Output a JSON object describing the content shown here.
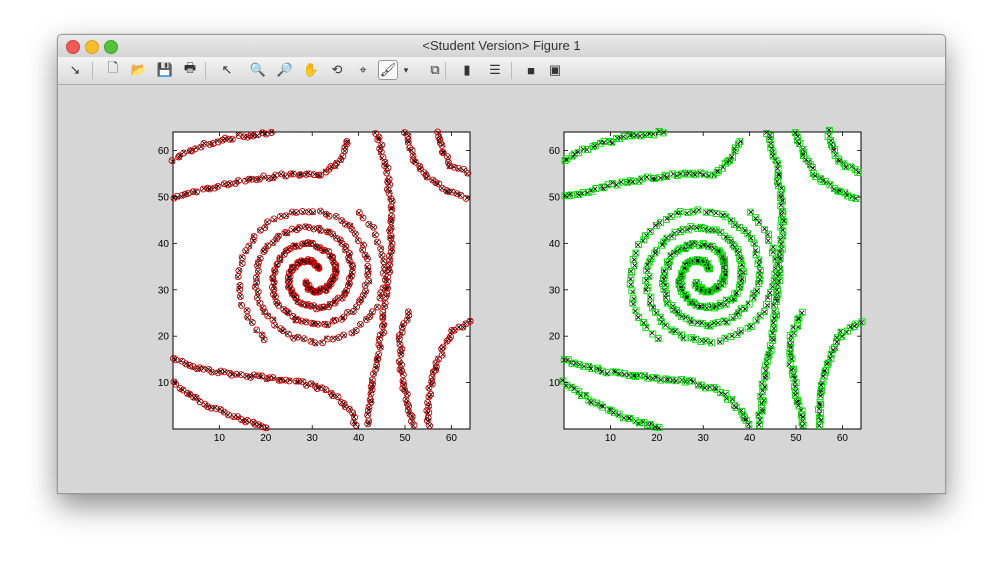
{
  "window": {
    "title": "<Student Version> Figure 1"
  },
  "toolbar": {
    "items": [
      {
        "name": "dock-arrow-icon",
        "glyph": "↘"
      },
      {
        "name": "new-figure-icon",
        "glyph": "🗋"
      },
      {
        "name": "open-file-icon",
        "glyph": "📂"
      },
      {
        "name": "save-icon",
        "glyph": "💾"
      },
      {
        "name": "print-icon",
        "glyph": "🖶"
      },
      {
        "name": "pointer-icon",
        "glyph": "↖"
      },
      {
        "name": "zoom-in-icon",
        "glyph": "🔍"
      },
      {
        "name": "zoom-out-icon",
        "glyph": "🔎"
      },
      {
        "name": "pan-hand-icon",
        "glyph": "✋"
      },
      {
        "name": "rotate-3d-icon",
        "glyph": "⟲"
      },
      {
        "name": "data-cursor-icon",
        "glyph": "⌖"
      },
      {
        "name": "brush-icon",
        "glyph": "🖌"
      },
      {
        "name": "brush-dropdown-icon",
        "glyph": "▾"
      },
      {
        "name": "link-plot-icon",
        "glyph": "⧉"
      },
      {
        "name": "colorbar-icon",
        "glyph": "▮"
      },
      {
        "name": "legend-icon",
        "glyph": "☰"
      },
      {
        "name": "hide-plot-tools-icon",
        "glyph": "■"
      },
      {
        "name": "show-plot-tools-icon",
        "glyph": "▣"
      }
    ]
  },
  "colors": {
    "red_marker": "#cc0000",
    "dark_marker": "#000000",
    "green_marker": "#00dd00"
  },
  "chart_data": [
    {
      "type": "scatter",
      "title": "",
      "xlabel": "",
      "ylabel": "",
      "xlim": [
        0,
        64
      ],
      "ylim": [
        0,
        64
      ],
      "xticks": [
        10,
        20,
        30,
        40,
        50,
        60
      ],
      "yticks": [
        10,
        20,
        30,
        40,
        50,
        60
      ],
      "grid": false,
      "series": [
        {
          "marker": "circle",
          "color": "#cc0000",
          "description_free": true
        },
        {
          "marker": "x",
          "color": "#000000"
        }
      ],
      "pattern": {
        "spiral_center": [
          30,
          33
        ],
        "spiral_pitch": 7.2,
        "spiral_arms": 2,
        "outer_bands": [
          {
            "points": [
              [
                0,
                58
              ],
              [
                6,
                61
              ],
              [
                14,
                63
              ],
              [
                22,
                64
              ]
            ]
          },
          {
            "points": [
              [
                0,
                50
              ],
              [
                8,
                52
              ],
              [
                18,
                54
              ],
              [
                26,
                55
              ],
              [
                32,
                55
              ],
              [
                36,
                58
              ],
              [
                38,
                63
              ]
            ]
          },
          {
            "points": [
              [
                0,
                15
              ],
              [
                6,
                13
              ],
              [
                12,
                12
              ],
              [
                20,
                11
              ],
              [
                28,
                10
              ],
              [
                34,
                8
              ],
              [
                38,
                4
              ],
              [
                40,
                0
              ]
            ]
          },
          {
            "points": [
              [
                0,
                10
              ],
              [
                6,
                6
              ],
              [
                12,
                3
              ],
              [
                18,
                1
              ],
              [
                21,
                0
              ]
            ]
          },
          {
            "points": [
              [
                44,
                64
              ],
              [
                46,
                56
              ],
              [
                47,
                48
              ],
              [
                47,
                40
              ],
              [
                46,
                30
              ],
              [
                45,
                20
              ],
              [
                43,
                10
              ],
              [
                42,
                0
              ]
            ]
          },
          {
            "points": [
              [
                50,
                64
              ],
              [
                52,
                58
              ],
              [
                55,
                54
              ],
              [
                58,
                52
              ],
              [
                62,
                50
              ],
              [
                64,
                50
              ]
            ]
          },
          {
            "points": [
              [
                57,
                64
              ],
              [
                58,
                60
              ],
              [
                60,
                57
              ],
              [
                64,
                55
              ]
            ]
          },
          {
            "points": [
              [
                64,
                23
              ],
              [
                60,
                21
              ],
              [
                58,
                17
              ],
              [
                56,
                12
              ],
              [
                55,
                6
              ],
              [
                55,
                0
              ]
            ]
          },
          {
            "points": [
              [
                51,
                25
              ],
              [
                49,
                20
              ],
              [
                49,
                14
              ],
              [
                50,
                8
              ],
              [
                51,
                4
              ],
              [
                52,
                0
              ]
            ]
          }
        ]
      }
    },
    {
      "type": "scatter",
      "title": "",
      "xlabel": "",
      "ylabel": "",
      "xlim": [
        0,
        64
      ],
      "ylim": [
        0,
        64
      ],
      "xticks": [
        10,
        20,
        30,
        40,
        50,
        60
      ],
      "yticks": [
        10,
        20,
        30,
        40,
        50,
        60
      ],
      "grid": false,
      "series": [
        {
          "marker": "x",
          "color": "#000000"
        },
        {
          "marker": "square",
          "color": "#00dd00"
        }
      ],
      "pattern": {
        "same_as": 0
      }
    }
  ]
}
